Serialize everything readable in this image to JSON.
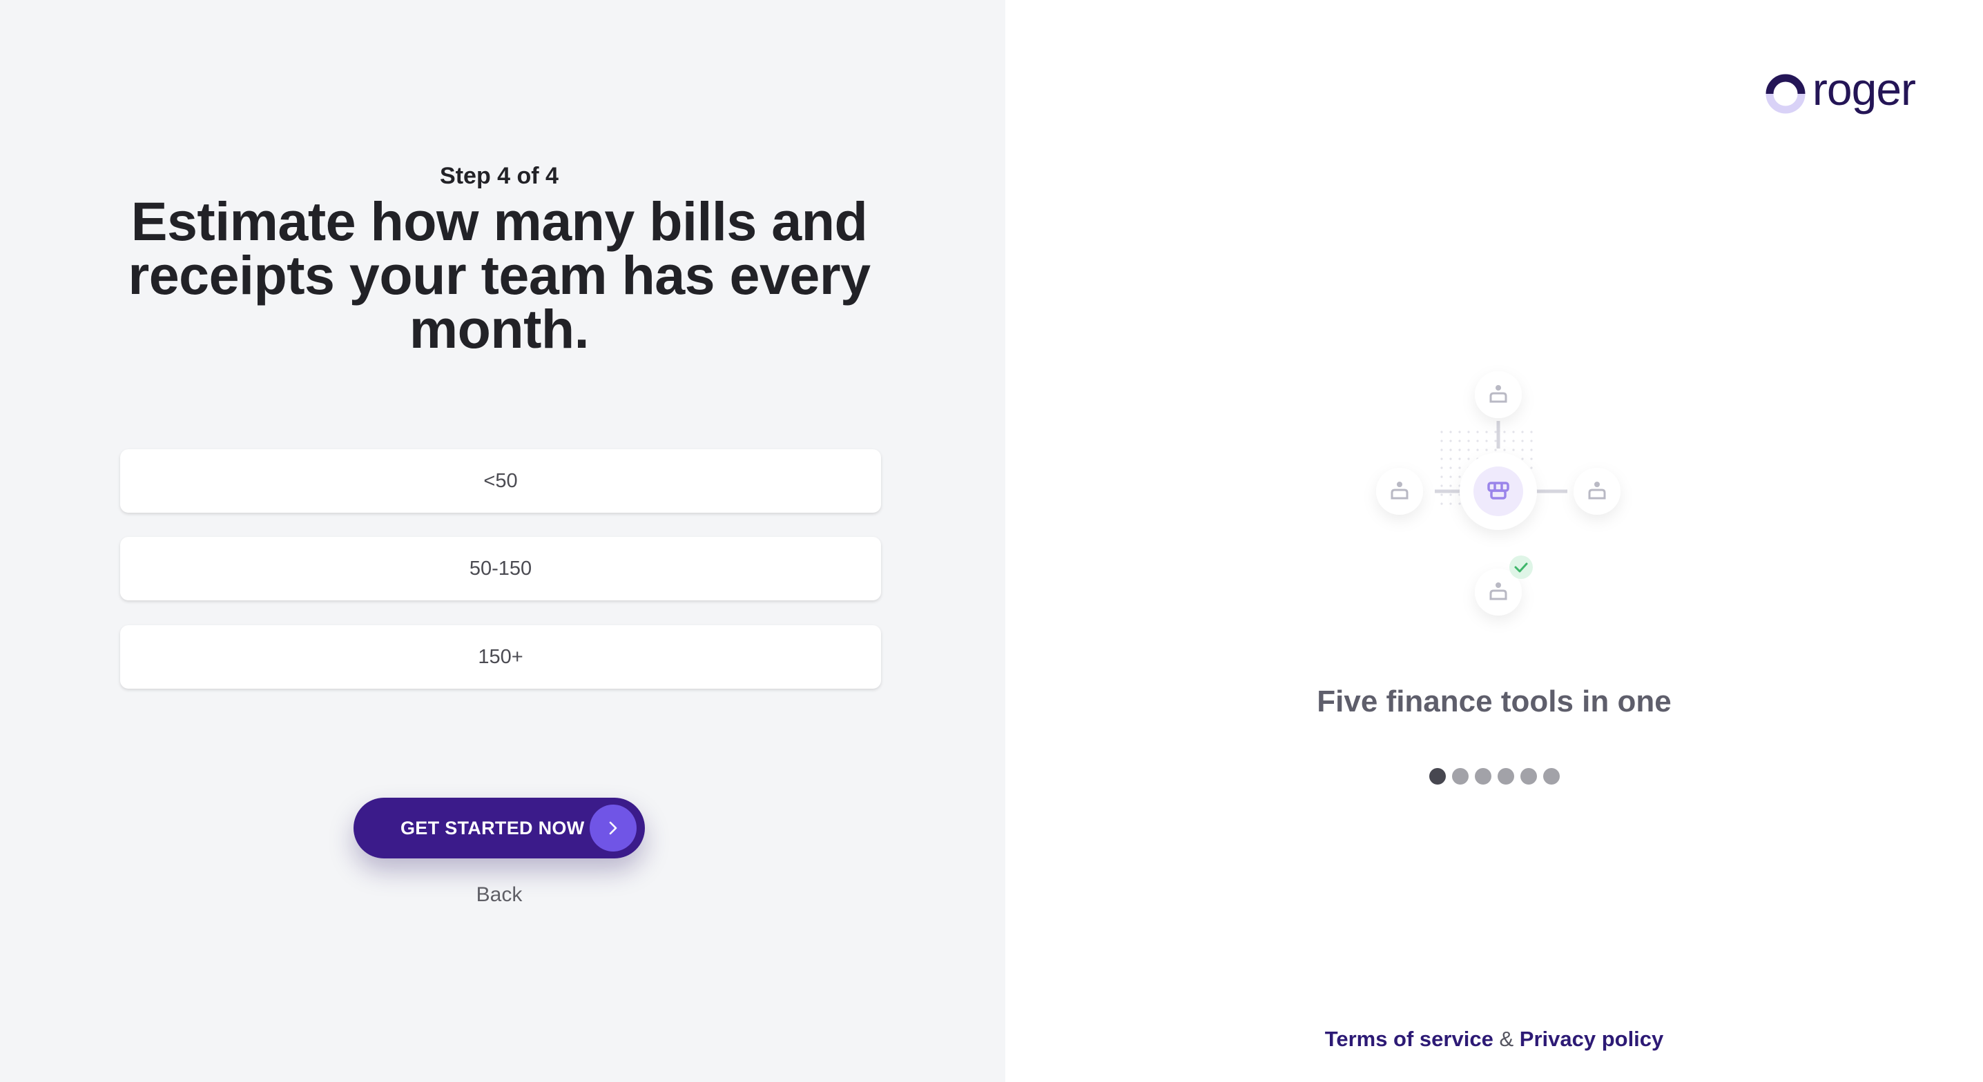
{
  "onboarding": {
    "step_label": "Step 4 of 4",
    "title": "Estimate how many bills and receipts your team has every month.",
    "options": [
      "<50",
      "50-150",
      "150+"
    ],
    "cta_label": "GET STARTED NOW",
    "back_label": "Back"
  },
  "brand": {
    "name": "roger",
    "color_dark": "#241556",
    "color_light": "#d9d2f7"
  },
  "carousel": {
    "tagline": "Five finance tools in one",
    "total_slides": 6,
    "active_index": 0
  },
  "footer": {
    "terms_label": "Terms of service",
    "separator": "&",
    "privacy_label": "Privacy policy"
  },
  "colors": {
    "cta_background": "#3b1b8a",
    "cta_circle": "#7055e6",
    "left_panel_background": "#f4f5f7"
  }
}
